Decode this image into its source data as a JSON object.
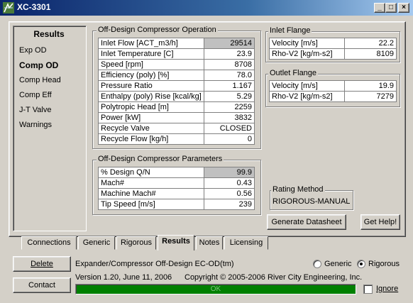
{
  "window": {
    "title": "XC-3301",
    "min": "_",
    "max": "□",
    "close": "×"
  },
  "nav": {
    "header": "Results",
    "items": [
      "Exp OD",
      "Comp OD",
      "Comp Head",
      "Comp Eff",
      "J-T Valve",
      "Warnings"
    ]
  },
  "operation": {
    "title": "Off-Design Compressor Operation",
    "rows": [
      {
        "label": "Inlet Flow [ACT_m3/h]",
        "value": "29514"
      },
      {
        "label": "Inlet Temperature [C]",
        "value": "23.9"
      },
      {
        "label": "Speed [rpm]",
        "value": "8708"
      },
      {
        "label": "Efficiency (poly) [%]",
        "value": "78.0"
      },
      {
        "label": "Pressure Ratio",
        "value": "1.167"
      },
      {
        "label": "Enthalpy (poly) Rise [kcal/kg]",
        "value": "5.29"
      },
      {
        "label": "Polytropic Head [m]",
        "value": "2259"
      },
      {
        "label": "Power [kW]",
        "value": "3832"
      },
      {
        "label": "Recycle Valve",
        "value": "CLOSED"
      },
      {
        "label": "Recycle Flow [kg/h]",
        "value": "0"
      }
    ]
  },
  "parameters": {
    "title": "Off-Design Compressor Parameters",
    "rows": [
      {
        "label": "% Design Q/N",
        "value": "99.9"
      },
      {
        "label": "Mach#",
        "value": "0.43"
      },
      {
        "label": "Machine Mach#",
        "value": "0.56"
      },
      {
        "label": "Tip Speed [m/s]",
        "value": "239"
      }
    ]
  },
  "inlet": {
    "title": "Inlet Flange",
    "rows": [
      {
        "label": "Velocity [m/s]",
        "value": "22.2"
      },
      {
        "label": "Rho-V2 [kg/m-s2]",
        "value": "8109"
      }
    ]
  },
  "outlet": {
    "title": "Outlet Flange",
    "rows": [
      {
        "label": "Velocity [m/s]",
        "value": "19.9"
      },
      {
        "label": "Rho-V2 [kg/m-s2]",
        "value": "7279"
      }
    ]
  },
  "rating": {
    "title": "Rating Method",
    "value": "RIGOROUS-MANUAL"
  },
  "buttons": {
    "datasheet": "Generate Datasheet",
    "help": "Get Help!",
    "delete": "Delete",
    "contact": "Contact"
  },
  "tabs": [
    "Connections",
    "Generic",
    "Rigorous",
    "Results",
    "Notes",
    "Licensing"
  ],
  "active_tab": "Results",
  "footer": {
    "description": "Expander/Compressor Off-Design EC-OD(tm)",
    "version": "Version 1.20, June 11, 2006",
    "copyright": "Copyright © 2005-2006 River City Engineering, Inc.",
    "status": "OK",
    "status_color": "#008000",
    "generic_label": "Generic",
    "rigorous_label": "Rigorous",
    "selected_mode": "Rigorous",
    "ignore_label": "Ignore",
    "ignore_checked": false
  }
}
